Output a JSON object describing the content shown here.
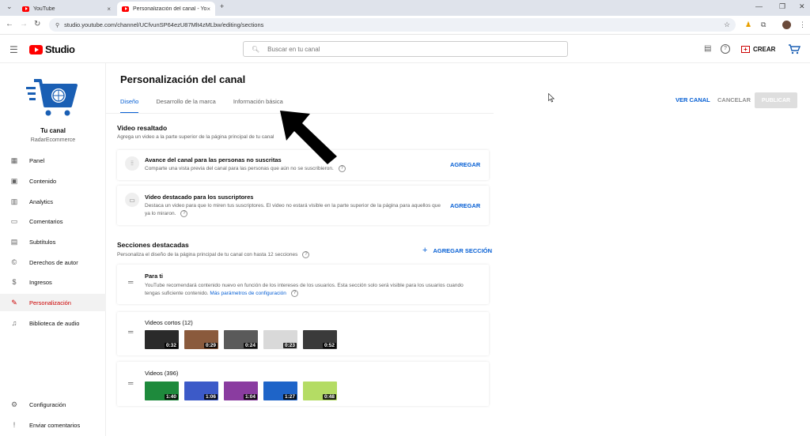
{
  "browser": {
    "tabs": [
      {
        "title": "YouTube",
        "close": "×"
      },
      {
        "title": "Personalización del canal - You",
        "close": "×"
      }
    ],
    "new_tab": "+",
    "url": "studio.youtube.com/channel/UCfvunSP64ezU87Mlt4zMLbw/editing/sections",
    "window_controls": {
      "minimize": "—",
      "restore": "❐",
      "close": "✕"
    }
  },
  "header": {
    "logo_text": "Studio",
    "search_placeholder": "Buscar en tu canal",
    "create_label": "CREAR"
  },
  "sidebar": {
    "channel_name": "Tu canal",
    "channel_handle": "RadarEcommerce",
    "items": [
      {
        "label": "Panel",
        "icon": "dashboard-icon",
        "glyph": "▦"
      },
      {
        "label": "Contenido",
        "icon": "content-icon",
        "glyph": "▣"
      },
      {
        "label": "Analytics",
        "icon": "analytics-icon",
        "glyph": "▥"
      },
      {
        "label": "Comentarios",
        "icon": "comments-icon",
        "glyph": "▭"
      },
      {
        "label": "Subtítulos",
        "icon": "subtitles-icon",
        "glyph": "▤"
      },
      {
        "label": "Derechos de autor",
        "icon": "copyright-icon",
        "glyph": "©"
      },
      {
        "label": "Ingresos",
        "icon": "earn-icon",
        "glyph": "$"
      },
      {
        "label": "Personalización",
        "icon": "customization-icon",
        "glyph": "✎"
      },
      {
        "label": "Biblioteca de audio",
        "icon": "audio-library-icon",
        "glyph": "♫"
      }
    ],
    "bottom_items": [
      {
        "label": "Configuración",
        "icon": "settings-icon",
        "glyph": "⚙"
      },
      {
        "label": "Enviar comentarios",
        "icon": "feedback-icon",
        "glyph": "!"
      }
    ]
  },
  "main": {
    "title": "Personalización del canal",
    "tabs": [
      {
        "label": "Diseño"
      },
      {
        "label": "Desarrollo de la marca"
      },
      {
        "label": "Información básica"
      }
    ],
    "actions": {
      "view_channel": "VER CANAL",
      "cancel": "CANCELAR",
      "publish": "PUBLICAR"
    },
    "featured_video": {
      "title": "Video resaltado",
      "description": "Agrega un video a la parte superior de la página principal de tu canal",
      "cards": [
        {
          "title": "Avance del canal para las personas no suscritas",
          "text": "Comparte una vista previa del canal para las personas que aún no se suscribieron.",
          "action": "AGREGAR"
        },
        {
          "title": "Video destacado para los suscriptores",
          "text": "Destaca un video para que lo miren tus suscriptores. El video no estará visible en la parte superior de la página para aquellos que ya lo miraron.",
          "action": "AGREGAR"
        }
      ]
    },
    "featured_sections": {
      "title": "Secciones destacadas",
      "description": "Personaliza el diseño de la página principal de tu canal con hasta 12 secciones",
      "add_section": "AGREGAR SECCIÓN",
      "for_you": {
        "title": "Para ti",
        "text": "YouTube recomendará contenido nuevo en función de los intereses de los usuarios. Esta sección solo será visible para los usuarios cuando tengas suficiente contenido.",
        "link": "Más parámetros de configuración"
      },
      "shorts": {
        "title": "Videos cortos (12)",
        "durations": [
          "0:32",
          "0:29",
          "0:24",
          "0:23",
          "0:52"
        ],
        "colors": [
          "#2a2a2a",
          "#8a5a3c",
          "#5a5a5a",
          "#d9d9d9",
          "#3a3a3a"
        ]
      },
      "videos": {
        "title": "Videos (396)",
        "durations": [
          "1:40",
          "1:06",
          "1:04",
          "1:27",
          "0:48"
        ],
        "colors": [
          "#1e8a3c",
          "#3c5ac8",
          "#8a3ca0",
          "#1e64c8",
          "#b4dc64"
        ]
      }
    }
  }
}
